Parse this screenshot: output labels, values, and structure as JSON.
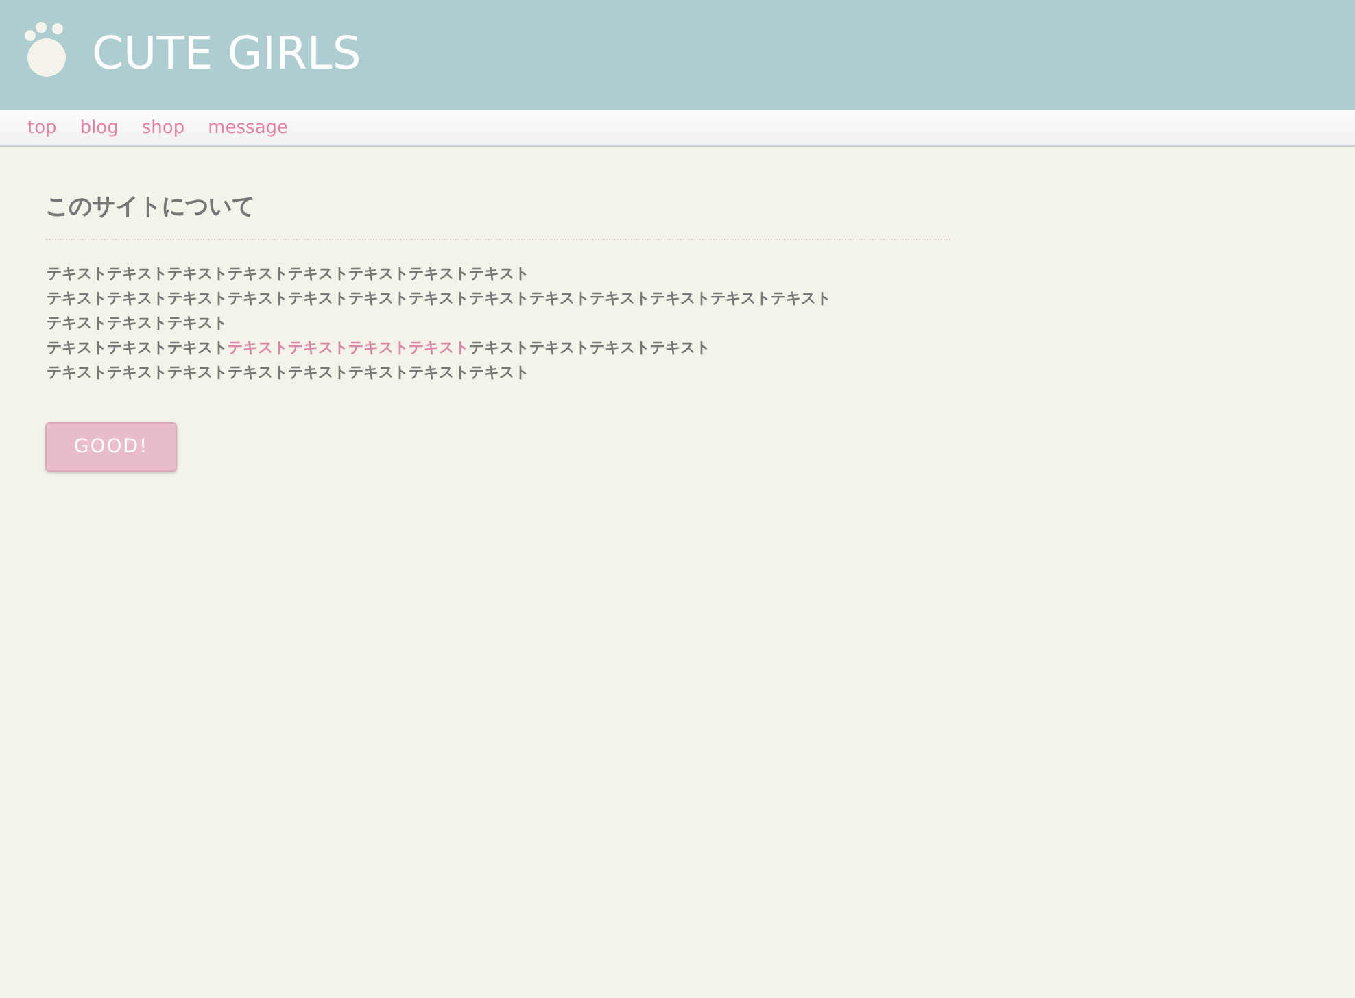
{
  "header": {
    "logo_text": "CUTE GIRLS"
  },
  "nav": [
    {
      "label": "top"
    },
    {
      "label": "blog"
    },
    {
      "label": "shop"
    },
    {
      "label": "message"
    }
  ],
  "section": {
    "heading": "このサイトについて",
    "lines": [
      [
        {
          "text": "テキストテキストテキストテキストテキストテキストテキストテキスト",
          "link": false
        }
      ],
      [
        {
          "text": "テキストテキストテキストテキストテキストテキストテキストテキストテキストテキストテキストテキストテキスト",
          "link": false
        }
      ],
      [
        {
          "text": "テキストテキストテキスト",
          "link": false
        }
      ],
      [
        {
          "text": "テキストテキストテキスト",
          "link": false
        },
        {
          "text": "テキストテキストテキストテキスト",
          "link": true
        },
        {
          "text": "テキストテキストテキストテキスト",
          "link": false
        }
      ],
      [
        {
          "text": "テキストテキストテキストテキストテキストテキストテキストテキスト",
          "link": false
        }
      ]
    ],
    "button": "GOOD!"
  }
}
